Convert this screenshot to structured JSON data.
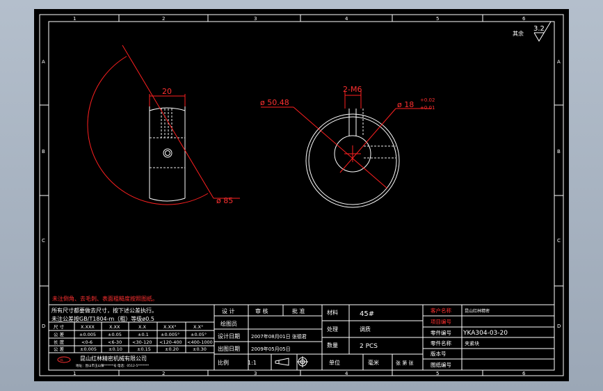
{
  "zone_numbers": [
    "1",
    "2",
    "3",
    "4",
    "5",
    "6"
  ],
  "zone_letters": [
    "A",
    "B",
    "C",
    "D"
  ],
  "roughness": {
    "prefix": "其余",
    "value": "3.2"
  },
  "dimensions": {
    "width_20": "20",
    "dia_85": "ø 85",
    "dia_5048": "ø 50.48",
    "thread": "2-M6",
    "dia_18": "ø 18",
    "tol_upper": "+0.02",
    "tol_lower": "+0.01"
  },
  "notes": {
    "red_note": "未注倒角、去毛刺、表面粗糙度按照图纸。",
    "line1": "所有尺寸都要做去尺寸，按下述公差执行。",
    "line2": "未注公差按GB/T1804-m（粗）等级ø0.5"
  },
  "tolerance_table": {
    "header": [
      "尺 寸",
      "X.XXX",
      "X.XX",
      "X.X",
      "X.XX°",
      "X.X°"
    ],
    "row1": [
      "公 差",
      "±0.005",
      "±0.05",
      "±0.1",
      "±0.005°",
      "±0.05°"
    ],
    "row2": [
      "长 度",
      "<0-6",
      "<6-30",
      "<30-120",
      "<120-400",
      "<400-1000"
    ],
    "row3": [
      "公 差",
      "±0.005",
      "±0.10",
      "±0.15",
      "±0.20",
      "±0.30"
    ]
  },
  "company": {
    "name": "昆山红林精密机械有限公司",
    "address": "地址：昆山市玉山镇******号  电话：0512-5*******"
  },
  "signature_block": {
    "design": "设  计",
    "check": "审  核",
    "approve": "批  准",
    "drawer": "绘图员",
    "design_date_label": "设计日期",
    "design_date": "2007年08月01日  张德君",
    "print_date_label": "出图日期",
    "print_date": "2009年05月05日",
    "scale_label": "比例",
    "scale_value": "1:1"
  },
  "material_block": {
    "material_label": "材料",
    "material_value": "45#",
    "treatment_label": "处理",
    "treatment_value": "调质",
    "qty_label": "数量",
    "qty_value": "2 PCS",
    "unit_label": "单位",
    "unit_value": "毫米",
    "sheet_label": "张  第  张"
  },
  "part_block": {
    "customer_label": "客户名称",
    "customer_value": "昆山红林精密",
    "project_label": "项目编号",
    "project_value": "",
    "part_no_label": "零件编号",
    "part_no_value": "YKA304-03-20",
    "part_name_label": "零件名称",
    "part_name_value": "夹紧块",
    "revision_label": "版本号",
    "revision_value": "",
    "drawing_no_label": "图纸编号",
    "drawing_no_value": ""
  }
}
